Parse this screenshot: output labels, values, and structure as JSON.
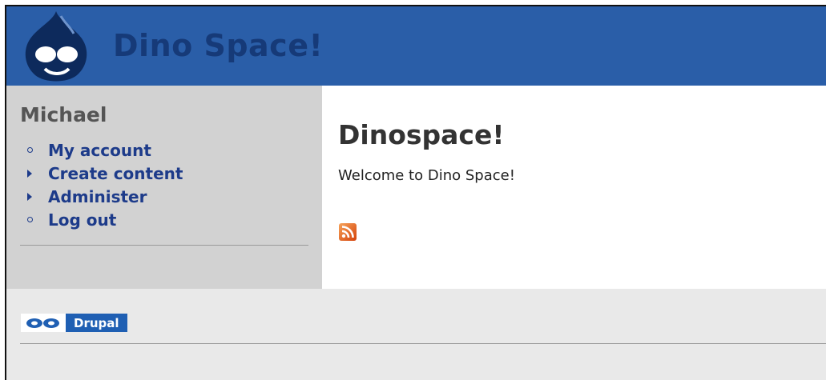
{
  "header": {
    "site_name": "Dino Space!",
    "logo_icon": "drupal-drop-logo-icon",
    "background_color": "#2a5ea8"
  },
  "sidebar": {
    "title": "Michael",
    "items": [
      {
        "label": "My account",
        "bullet": "circle"
      },
      {
        "label": "Create content",
        "bullet": "triangle"
      },
      {
        "label": "Administer",
        "bullet": "triangle"
      },
      {
        "label": "Log out",
        "bullet": "circle"
      }
    ]
  },
  "main": {
    "title": "Dinospace!",
    "welcome_text": "Welcome to Dino Space!",
    "feed_icon": "rss-icon"
  },
  "footer": {
    "badge_text": "Drupal",
    "badge_icon": "drupal-badge-icon"
  }
}
